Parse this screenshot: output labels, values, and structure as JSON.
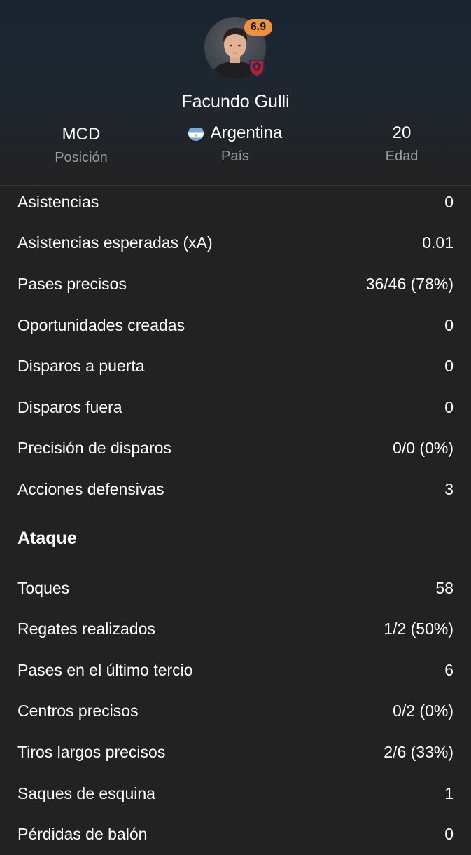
{
  "player": {
    "name": "Facundo Gulli",
    "rating": "6.9",
    "rating_color": "#f2913b",
    "position_value": "MCD",
    "position_label": "Posición",
    "country_value": "Argentina",
    "country_label": "País",
    "country_flag_icon": "argentina-flag-icon",
    "age_value": "20",
    "age_label": "Edad",
    "club_logo_icon": "club-crest-icon"
  },
  "stats_top": [
    {
      "label": "Asistencias",
      "value": "0"
    },
    {
      "label": "Asistencias esperadas (xA)",
      "value": "0.01"
    },
    {
      "label": "Pases precisos",
      "value": "36/46 (78%)"
    },
    {
      "label": "Oportunidades creadas",
      "value": "0"
    },
    {
      "label": "Disparos a puerta",
      "value": "0"
    },
    {
      "label": "Disparos fuera",
      "value": "0"
    },
    {
      "label": "Precisión de disparos",
      "value": "0/0 (0%)"
    },
    {
      "label": "Acciones defensivas",
      "value": "3"
    }
  ],
  "attack_section": {
    "title": "Ataque",
    "rows": [
      {
        "label": "Toques",
        "value": "58"
      },
      {
        "label": "Regates realizados",
        "value": "1/2 (50%)"
      },
      {
        "label": "Pases en el último tercio",
        "value": "6"
      },
      {
        "label": "Centros precisos",
        "value": "0/2 (0%)"
      },
      {
        "label": "Tiros largos precisos",
        "value": "2/6 (33%)"
      },
      {
        "label": "Saques de esquina",
        "value": "1"
      },
      {
        "label": "Pérdidas de balón",
        "value": "0"
      }
    ]
  }
}
